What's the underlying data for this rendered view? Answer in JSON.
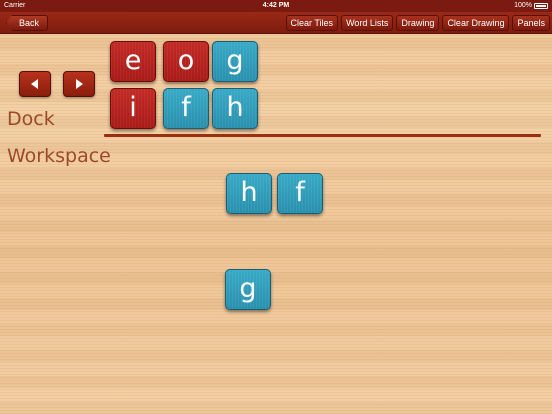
{
  "status_bar": {
    "carrier": "Carrier",
    "time": "4:42 PM",
    "battery": "100%"
  },
  "toolbar": {
    "back_label": "Back",
    "buttons": [
      "Clear Tiles",
      "Word Lists",
      "Drawing",
      "Clear Drawing",
      "Panels"
    ]
  },
  "labels": {
    "dock": "Dock",
    "workspace": "Workspace"
  },
  "colors": {
    "toolbar": "#7e1d0f",
    "red_tile": "#b3211d",
    "blue_tile": "#2f9ab8",
    "label": "#9b4a2a"
  },
  "dock_tiles": [
    {
      "letter": "e",
      "color": "red"
    },
    {
      "letter": "o",
      "color": "red"
    },
    {
      "letter": "g",
      "color": "blue"
    },
    {
      "letter": "i",
      "color": "red"
    },
    {
      "letter": "f",
      "color": "blue"
    },
    {
      "letter": "h",
      "color": "blue"
    }
  ],
  "workspace_tiles": [
    {
      "letter": "h",
      "color": "blue"
    },
    {
      "letter": "f",
      "color": "blue"
    },
    {
      "letter": "g",
      "color": "blue"
    }
  ],
  "icons": {
    "prev": "left-arrow-icon",
    "next": "right-arrow-icon"
  }
}
